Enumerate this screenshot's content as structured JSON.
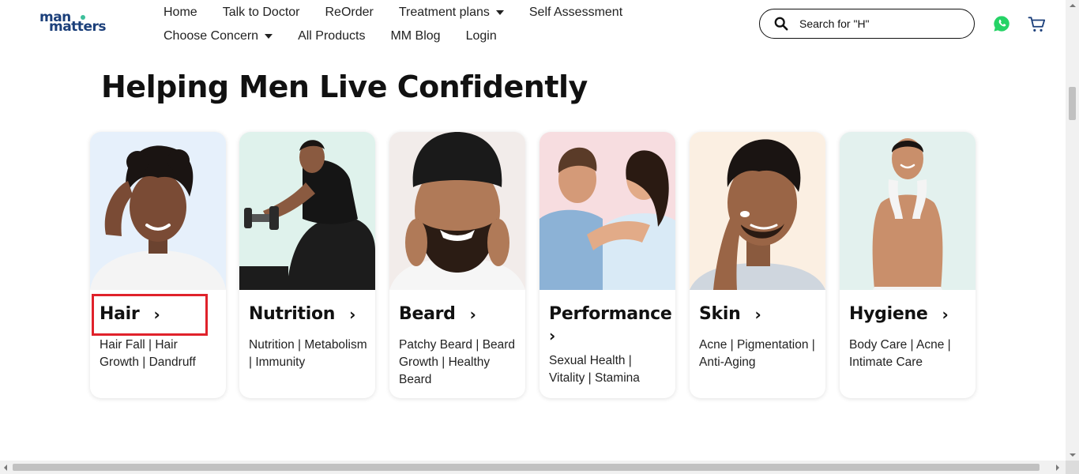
{
  "brand": {
    "logo_line1": "man",
    "logo_line2": "matters",
    "accent": "#1b3f7a",
    "dot_color": "#3dbf9b"
  },
  "nav": {
    "row1": [
      "Home",
      "Talk to Doctor",
      "ReOrder",
      "Treatment plans",
      "Self Assessment"
    ],
    "row2": [
      "Choose Concern",
      "All Products",
      "MM Blog",
      "Login"
    ],
    "dropdowns": [
      "Treatment plans",
      "Choose Concern"
    ]
  },
  "search": {
    "placeholder": "Search for \"H\"",
    "icon": "search-icon"
  },
  "icons": {
    "whatsapp": "whatsapp-icon",
    "cart": "cart-icon",
    "whatsapp_color": "#25d366"
  },
  "heading": "Helping Men Live Confidently",
  "cards": [
    {
      "title": "Hair",
      "chevron": "›",
      "desc": "Hair Fall | Hair Growth | Dandruff",
      "bg": "#e6f0fb"
    },
    {
      "title": "Nutrition",
      "chevron": "›",
      "desc": "Nutrition | Metabolism | Immunity",
      "bg": "#dff2ec"
    },
    {
      "title": "Beard",
      "chevron": "›",
      "desc": "Patchy Beard | Beard Growth | Healthy Beard",
      "bg": "#f2ecea"
    },
    {
      "title": "Performance",
      "chevron": "›",
      "desc": "Sexual Health | Vitality | Stamina",
      "bg": "#f7dde0"
    },
    {
      "title": "Skin",
      "chevron": "›",
      "desc": "Acne | Pigmentation | Anti-Aging",
      "bg": "#fbefe2"
    },
    {
      "title": "Hygiene",
      "chevron": "›",
      "desc": "Body Care | Acne | Intimate Care",
      "bg": "#e3f1ee"
    }
  ],
  "highlight_color": "#e0222b"
}
